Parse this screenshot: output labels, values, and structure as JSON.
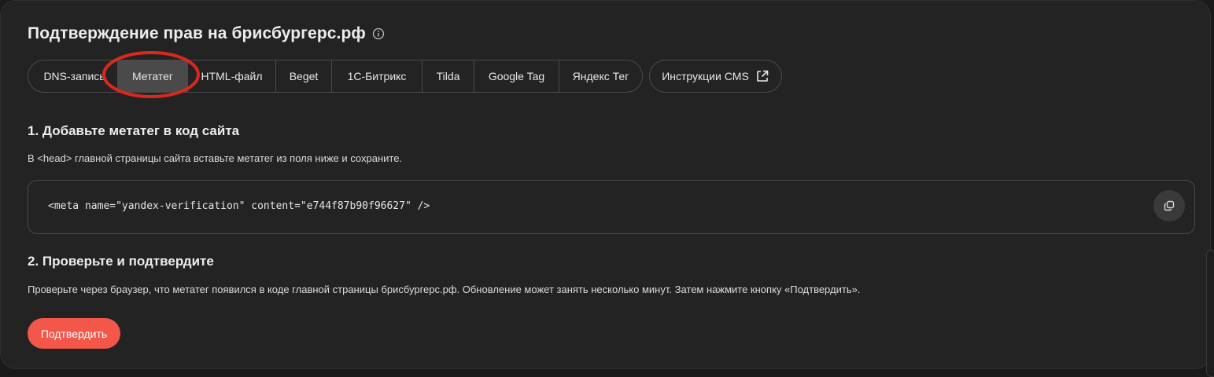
{
  "page": {
    "title": "Подтверждение прав на брисбургерс.рф",
    "info_icon": "info-icon"
  },
  "tabs": [
    {
      "label": "DNS-запись",
      "active": false
    },
    {
      "label": "Метатег",
      "active": true
    },
    {
      "label": "HTML-файл",
      "active": false
    },
    {
      "label": "Beget",
      "active": false
    },
    {
      "label": "1С-Битрикс",
      "active": false
    },
    {
      "label": "Tilda",
      "active": false
    },
    {
      "label": "Google Tag",
      "active": false
    },
    {
      "label": "Яндекс Тег",
      "active": false
    }
  ],
  "cms_button": {
    "label": "Инструкции CMS",
    "icon": "external-link-icon"
  },
  "step1": {
    "heading": "1. Добавьте метатег в код сайта",
    "text": "В <head> главной страницы сайта вставьте метатег из поля ниже и сохраните.",
    "code": "<meta name=\"yandex-verification\" content=\"e744f87b90f96627\" />",
    "copy_icon": "copy-icon"
  },
  "step2": {
    "heading": "2. Проверьте и подтвердите",
    "text": "Проверьте через браузер, что метатег появился в коде главной страницы брисбургерс.рф. Обновление может занять несколько минут. Затем нажмите кнопку «Подтвердить»."
  },
  "confirm_button": {
    "label": "Подтвердить"
  },
  "colors": {
    "background": "#232323",
    "accent": "#f2574a",
    "annotation": "#d9291c",
    "active_tab": "#4a4a4a"
  }
}
